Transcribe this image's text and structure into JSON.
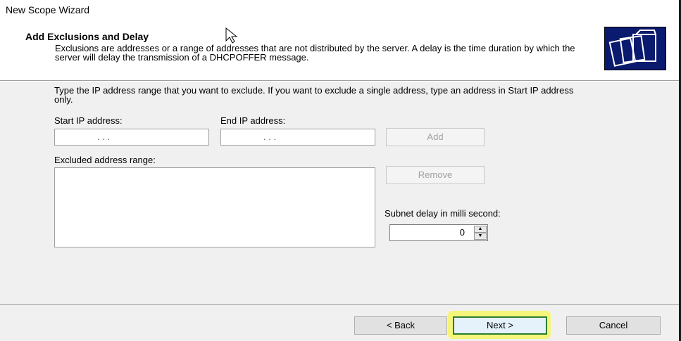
{
  "window": {
    "title": "New Scope Wizard"
  },
  "header": {
    "title": "Add Exclusions and Delay",
    "description": "Exclusions are addresses or a range of addresses that are not distributed by the server. A delay is the time duration by which the server will delay the transmission of a DHCPOFFER message."
  },
  "form": {
    "instructions": "Type the IP address range that you want to exclude. If you want to exclude a single address, type an address in Start IP address only.",
    "start_ip_label": "Start IP address:",
    "end_ip_label": "End IP address:",
    "start_ip_value": ".   .   .",
    "end_ip_value": ".   .   .",
    "add_label": "Add",
    "excluded_label": "Excluded address range:",
    "remove_label": "Remove",
    "delay_label": "Subnet delay in milli second:",
    "delay_value": "0"
  },
  "footer": {
    "back_label": "< Back",
    "next_label": "Next >",
    "cancel_label": "Cancel"
  },
  "colors": {
    "highlight": "#f4f57a",
    "next_border": "#2e7d32"
  }
}
